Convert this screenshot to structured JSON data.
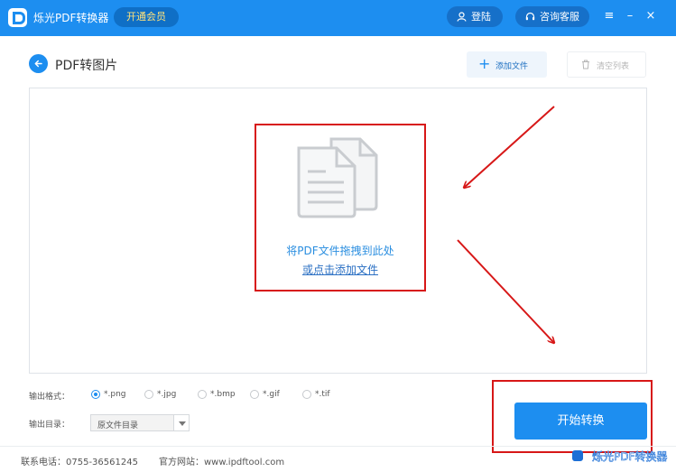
{
  "app": {
    "title": "烁光PDF转换器",
    "vip_label": "开通会员",
    "login_label": "登陆",
    "service_label": "咨询客服",
    "window_controls": {
      "menu": "≡",
      "minimize": "–",
      "close": "×"
    }
  },
  "header": {
    "title": "PDF转图片",
    "add_file_label": "添加文件",
    "clear_list_label": "清空列表"
  },
  "dropzone": {
    "hint": "将PDF文件拖拽到此处",
    "link": "或点击添加文件"
  },
  "options": {
    "format_label": "输出格式：",
    "formats": [
      "*.png",
      "*.jpg",
      "*.bmp",
      "*.gif",
      "*.tif"
    ],
    "selected_format": "*.png",
    "directory_label": "输出目录：",
    "directory_value": "原文件目录"
  },
  "start_label": "开始转换",
  "footer": {
    "phone": "联系电话：0755-36561245",
    "website": "官方网站：www.ipdftool.com"
  },
  "watermark": "烁光PDF转换器",
  "colors": {
    "brand": "#1d8ef0",
    "annotation": "#d71717",
    "link": "#2a6fc3"
  },
  "icons": {
    "back": "arrow-left-icon",
    "add": "plus-icon",
    "clear": "trash-icon",
    "document": "documents-icon",
    "login": "user-icon",
    "service": "headset-icon"
  }
}
